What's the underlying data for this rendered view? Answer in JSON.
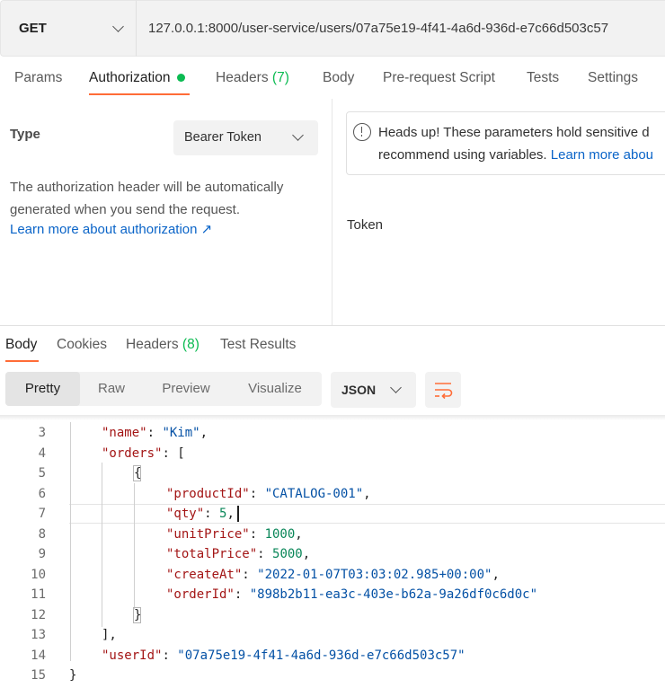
{
  "request": {
    "method": "GET",
    "url": "127.0.0.1:8000/user-service/users/07a75e19-4f41-4a6d-936d-e7c66d503c57",
    "tabs": {
      "params": "Params",
      "authorization": "Authorization",
      "headers": "Headers",
      "headers_count": "(7)",
      "body": "Body",
      "prerequest": "Pre-request Script",
      "tests": "Tests",
      "settings": "Settings"
    }
  },
  "auth": {
    "type_label": "Type",
    "type_value": "Bearer Token",
    "desc_line1": "The authorization header will be automatically",
    "desc_line2": "generated when you send the request.",
    "learn_more": "Learn more about authorization ↗",
    "alert_line1": "Heads up! These parameters hold sensitive d",
    "alert_line2": "recommend using variables.",
    "alert_link": "Learn more abou",
    "token_label": "Token"
  },
  "response": {
    "tabs": {
      "body": "Body",
      "cookies": "Cookies",
      "headers": "Headers",
      "headers_count": "(8)",
      "test_results": "Test Results"
    },
    "views": [
      "Pretty",
      "Raw",
      "Preview",
      "Visualize"
    ],
    "active_view": "Pretty",
    "format": "JSON"
  },
  "code": {
    "line_numbers": [
      "3",
      "4",
      "5",
      "6",
      "7",
      "8",
      "9",
      "10",
      "11",
      "12",
      "13",
      "14",
      "15"
    ],
    "name_key": "\"name\"",
    "name_val": "\"Kim\"",
    "orders_key": "\"orders\"",
    "productId_key": "\"productId\"",
    "productId_val": "\"CATALOG-001\"",
    "qty_key": "\"qty\"",
    "qty_val": "5",
    "unitPrice_key": "\"unitPrice\"",
    "unitPrice_val": "1000",
    "totalPrice_key": "\"totalPrice\"",
    "totalPrice_val": "5000",
    "createAt_key": "\"createAt\"",
    "createAt_val": "\"2022-01-07T03:03:02.985+00:00\"",
    "orderId_key": "\"orderId\"",
    "orderId_val": "\"898b2b11-ea3c-403e-b62a-9a26df0c6d0c\"",
    "userId_key": "\"userId\"",
    "userId_val": "\"07a75e19-4f41-4a6d-936d-e7c66d503c57\""
  },
  "colors": {
    "accent": "#ff6c37",
    "success": "#0cbb52",
    "link": "#0a64c8"
  }
}
